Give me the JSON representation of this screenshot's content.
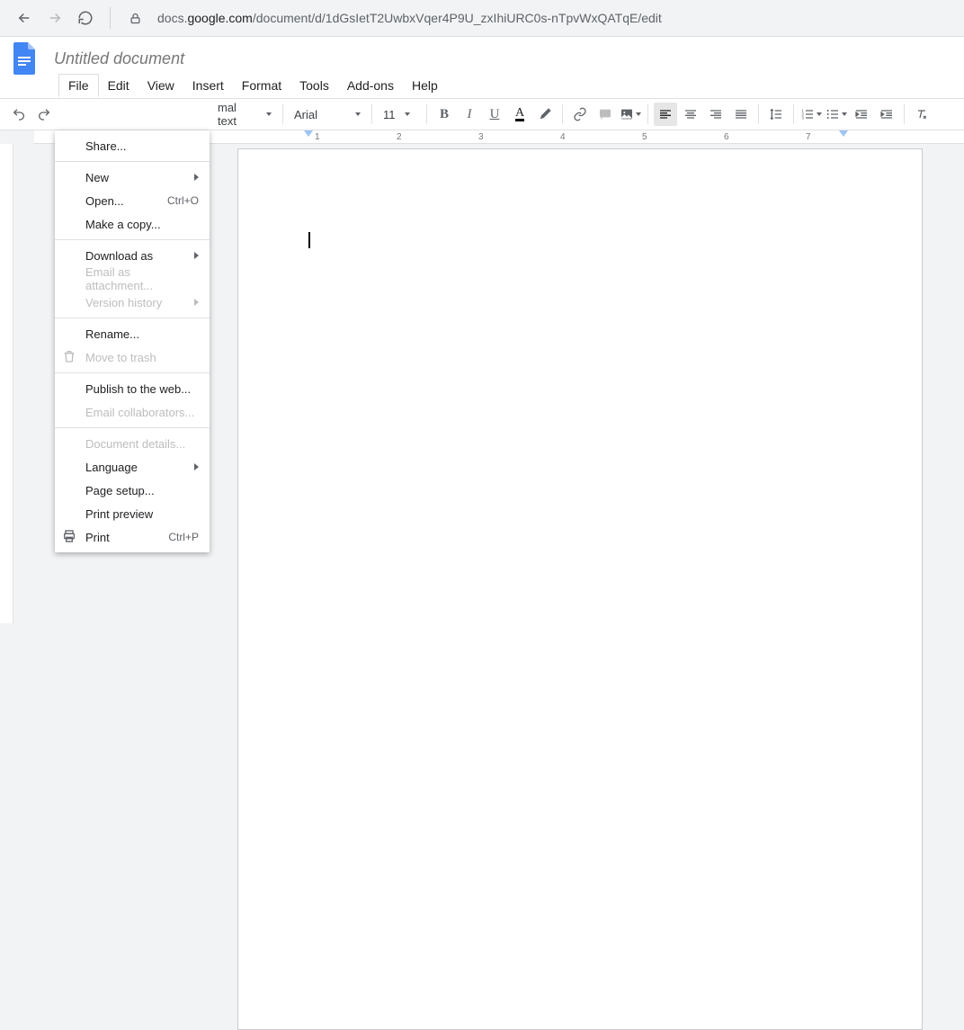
{
  "browser": {
    "url_prefix": "docs.",
    "url_host": "google.com",
    "url_path": "/document/d/1dGsIetT2UwbxVqer4P9U_zxIhiURC0s-nTpvWxQATqE/edit"
  },
  "doc": {
    "title": "Untitled document"
  },
  "menus": [
    "File",
    "Edit",
    "View",
    "Insert",
    "Format",
    "Tools",
    "Add-ons",
    "Help"
  ],
  "toolbar": {
    "styles": "mal text",
    "font": "Arial",
    "size": "11"
  },
  "ruler_ticks": [
    "1",
    "2",
    "3",
    "4",
    "5",
    "6",
    "7"
  ],
  "file_menu": {
    "share": "Share...",
    "new": "New",
    "open": "Open...",
    "open_sc": "Ctrl+O",
    "copy": "Make a copy...",
    "download": "Download as",
    "email_att": "Email as attachment...",
    "version": "Version history",
    "rename": "Rename...",
    "trash": "Move to trash",
    "publish": "Publish to the web...",
    "email_collab": "Email collaborators...",
    "details": "Document details...",
    "language": "Language",
    "page_setup": "Page setup...",
    "print_preview": "Print preview",
    "print": "Print",
    "print_sc": "Ctrl+P"
  }
}
